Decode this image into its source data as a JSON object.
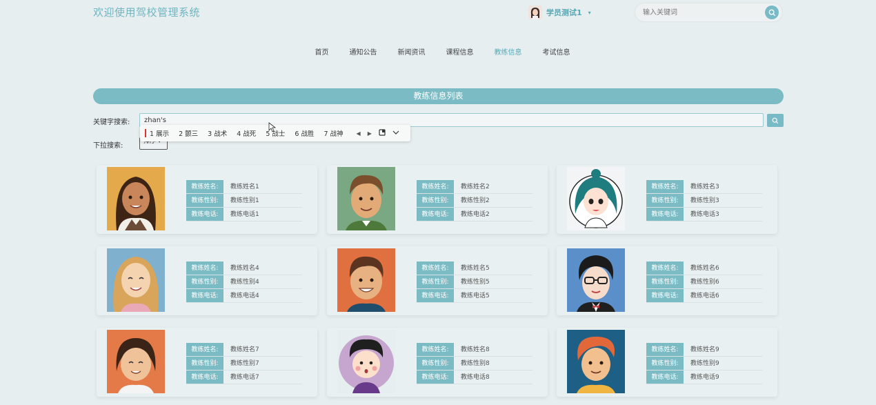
{
  "header": {
    "site_title": "欢迎使用驾校管理系统",
    "user_name": "学员测试1",
    "caret": "▾",
    "search_placeholder": "输入关键词"
  },
  "nav": {
    "items": [
      {
        "label": "首页",
        "active": false
      },
      {
        "label": "通知公告",
        "active": false
      },
      {
        "label": "新闻资讯",
        "active": false
      },
      {
        "label": "课程信息",
        "active": false
      },
      {
        "label": "教练信息",
        "active": true
      },
      {
        "label": "考试信息",
        "active": false
      }
    ]
  },
  "banner": {
    "title": "教练信息列表"
  },
  "search": {
    "keyword_label": "关键字搜索:",
    "keyword_value": "zhan's",
    "dropdown_label": "下拉搜索:",
    "dropdown_value": "排序 ▾"
  },
  "ime": {
    "candidates": [
      "1 展示",
      "2 颤三",
      "3 战术",
      "4 战死",
      "5 战士",
      "6 战胜",
      "7 战神"
    ]
  },
  "field_labels": {
    "name": "教练姓名:",
    "gender": "教练性别:",
    "phone": "教练电话:"
  },
  "coaches": [
    {
      "name": "教练姓名1",
      "gender": "教练性别1",
      "phone": "教练电话1",
      "avatar": "woman-dark-hair"
    },
    {
      "name": "教练姓名2",
      "gender": "教练性别2",
      "phone": "教练电话2",
      "avatar": "man-brown-hair"
    },
    {
      "name": "教练姓名3",
      "gender": "教练性别3",
      "phone": "教练电话3",
      "avatar": "woman-teal-hair"
    },
    {
      "name": "教练姓名4",
      "gender": "教练性别4",
      "phone": "教练电话4",
      "avatar": "woman-blonde"
    },
    {
      "name": "教练姓名5",
      "gender": "教练性别5",
      "phone": "教练电话5",
      "avatar": "man-smiling"
    },
    {
      "name": "教练姓名6",
      "gender": "教练性别6",
      "phone": "教练电话6",
      "avatar": "man-glasses"
    },
    {
      "name": "教练姓名7",
      "gender": "教练性别7",
      "phone": "教练电话7",
      "avatar": "woman-short-hair"
    },
    {
      "name": "教练姓名8",
      "gender": "教练性别8",
      "phone": "教练电话8",
      "avatar": "boy-round"
    },
    {
      "name": "教练姓名9",
      "gender": "教练性别9",
      "phone": "教练电话9",
      "avatar": "man-red-hair"
    }
  ],
  "colors": {
    "accent": "#7bbbc4",
    "background": "#e6eef0"
  }
}
